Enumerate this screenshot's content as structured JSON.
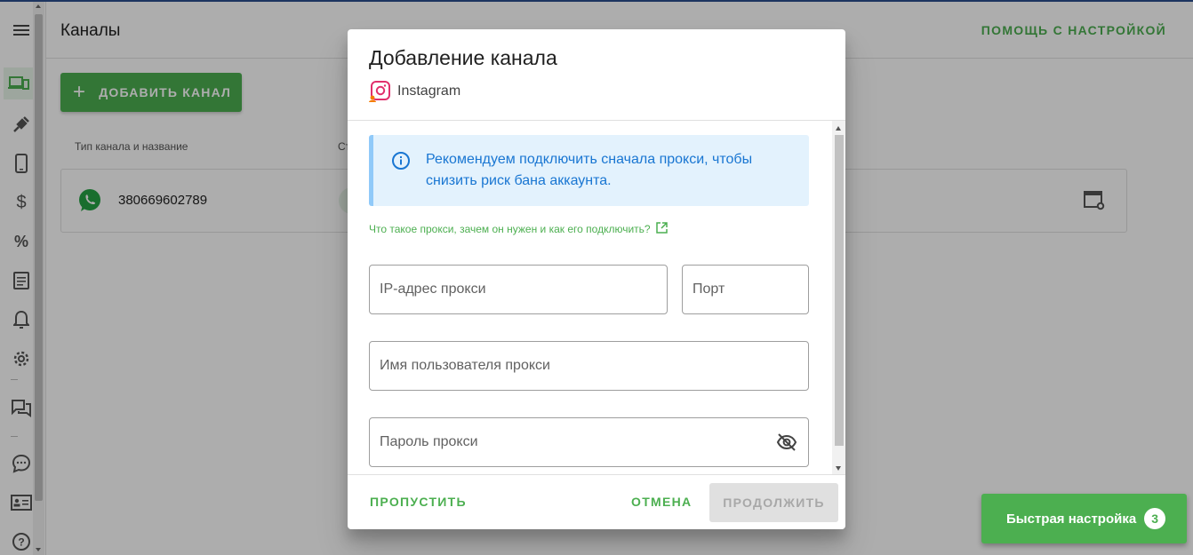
{
  "header": {
    "title": "Каналы",
    "help_link": "ПОМОЩЬ С НАСТРОЙКОЙ"
  },
  "sidebar": {
    "items": [
      {
        "icon": "menu-icon"
      },
      {
        "icon": "devices-icon",
        "active": true
      },
      {
        "icon": "plug-icon"
      },
      {
        "icon": "phone-icon"
      },
      {
        "icon": "dollar-icon"
      },
      {
        "icon": "percent-icon"
      },
      {
        "icon": "document-icon"
      },
      {
        "icon": "bell-icon"
      },
      {
        "icon": "gear-icon"
      },
      {
        "icon": "chat-bubbles-icon"
      },
      {
        "icon": "comment-icon"
      },
      {
        "icon": "contact-card-icon"
      },
      {
        "icon": "help-icon"
      }
    ]
  },
  "main": {
    "add_button": "ДОБАВИТЬ КАНАЛ",
    "columns": [
      "Тип канала и название",
      "Ст"
    ],
    "channels": [
      {
        "type_icon": "whatsapp-icon",
        "name": "380669602789"
      }
    ]
  },
  "dialog": {
    "title": "Добавление канала",
    "channel_type": "Instagram",
    "alert_text": "Рекомендуем подключить сначала прокси, чтобы снизить риск бана аккаунта.",
    "proxy_link": "Что такое прокси, зачем он нужен и как его подключить?",
    "fields": {
      "ip_placeholder": "IP-адрес прокси",
      "port_placeholder": "Порт",
      "user_placeholder": "Имя пользователя прокси",
      "password_placeholder": "Пароль прокси"
    },
    "buttons": {
      "skip": "ПРОПУСТИТЬ",
      "cancel": "ОТМЕНА",
      "continue": "ПРОДОЛЖИТЬ"
    }
  },
  "quick_setup": {
    "label": "Быстрая настройка",
    "count": "3"
  },
  "colors": {
    "accent": "#4caf50",
    "info": "#1976d2",
    "info_bg": "#e3f2fd"
  }
}
